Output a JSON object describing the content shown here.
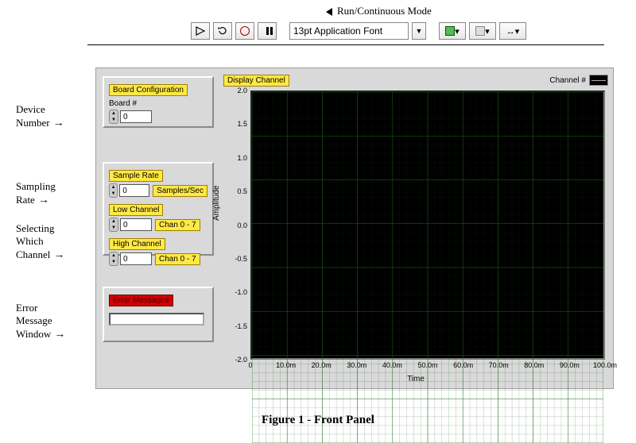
{
  "annotations": {
    "run_mode": "Run/Continuous Mode",
    "device_number": "Device\nNumber",
    "sampling_rate": "Sampling\nRate",
    "selecting_channel": "Selecting\nWhich\nChannel",
    "error_window": "Error\nMessage\nWindow"
  },
  "toolbar": {
    "font_display": "13pt Application Font"
  },
  "panel": {
    "board_config": {
      "title": "Board Configuration",
      "board_num_label": "Board #",
      "board_num_value": "0"
    },
    "sampling": {
      "sample_rate_label": "Sample Rate",
      "sample_rate_value": "0",
      "sample_rate_unit": "Samples/Sec",
      "low_ch_label": "Low Channel",
      "low_ch_value": "0",
      "low_ch_unit": "Chan 0 - 7",
      "high_ch_label": "High Channel",
      "high_ch_value": "0",
      "high_ch_unit": "Chan 0 - 7"
    },
    "errors": {
      "title": "Error Messages",
      "value": ""
    },
    "graph": {
      "title": "Display Channel",
      "legend_label": "Channel #",
      "ylabel": "Amplitude",
      "xlabel": "Time"
    }
  },
  "chart_data": {
    "type": "line",
    "title": "Display Channel",
    "xlabel": "Time",
    "ylabel": "Amplitude",
    "xlim": [
      0,
      0.1
    ],
    "ylim": [
      -2.0,
      2.0
    ],
    "x_ticks": [
      "0",
      "10.0m",
      "20.0m",
      "30.0m",
      "40.0m",
      "50.0m",
      "60.0m",
      "70.0m",
      "80.0m",
      "90.0m",
      "100.0m"
    ],
    "y_ticks": [
      "-2.0",
      "-1.5",
      "-1.0",
      "-0.5",
      "0.0",
      "0.5",
      "1.0",
      "1.5",
      "2.0"
    ],
    "series": [
      {
        "name": "Channel #",
        "x": [],
        "y": []
      }
    ]
  },
  "caption": {
    "fig": "Figure 1",
    "sep": " - ",
    "title": "Front Panel"
  }
}
